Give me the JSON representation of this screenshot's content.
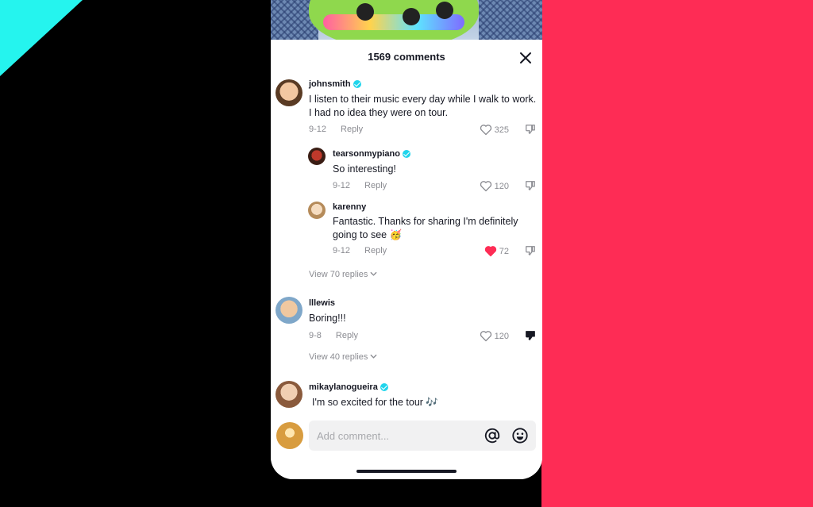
{
  "header": {
    "title": "1569 comments"
  },
  "comments": [
    {
      "username": "johnsmith",
      "verified": true,
      "text": "I listen to their music every day while I walk to work. I had no idea they were on tour.",
      "date": "9-12",
      "reply_label": "Reply",
      "likes": "325",
      "liked": false,
      "disliked": false,
      "replies": [
        {
          "username": "tearsonmypiano",
          "verified": true,
          "text": "So interesting!",
          "date": "9-12",
          "reply_label": "Reply",
          "likes": "120",
          "liked": false
        },
        {
          "username": "karenny",
          "verified": false,
          "text": "Fantastic. Thanks for sharing I'm definitely going to see 🥳",
          "date": "9-12",
          "reply_label": "Reply",
          "likes": "72",
          "liked": true
        }
      ],
      "view_replies": "View 70 replies"
    },
    {
      "username": "lllewis",
      "verified": false,
      "text": "Boring!!!",
      "date": "9-8",
      "reply_label": "Reply",
      "likes": "120",
      "liked": false,
      "disliked": true,
      "view_replies": "View 40 replies"
    },
    {
      "username": "mikaylanogueira",
      "verified": true,
      "text": "I'm so excited for the tour 🎶"
    }
  ],
  "composer": {
    "placeholder": "Add comment..."
  },
  "colors": {
    "brand_red": "#fe2c55",
    "brand_cyan": "#25f4ee",
    "verified": "#20d5ec",
    "liked_heart": "#fe2c55"
  },
  "icons": [
    "close-icon",
    "heart-icon",
    "dislike-icon",
    "chevron-down-icon",
    "at-icon",
    "emoji-icon",
    "verified-badge-icon"
  ]
}
